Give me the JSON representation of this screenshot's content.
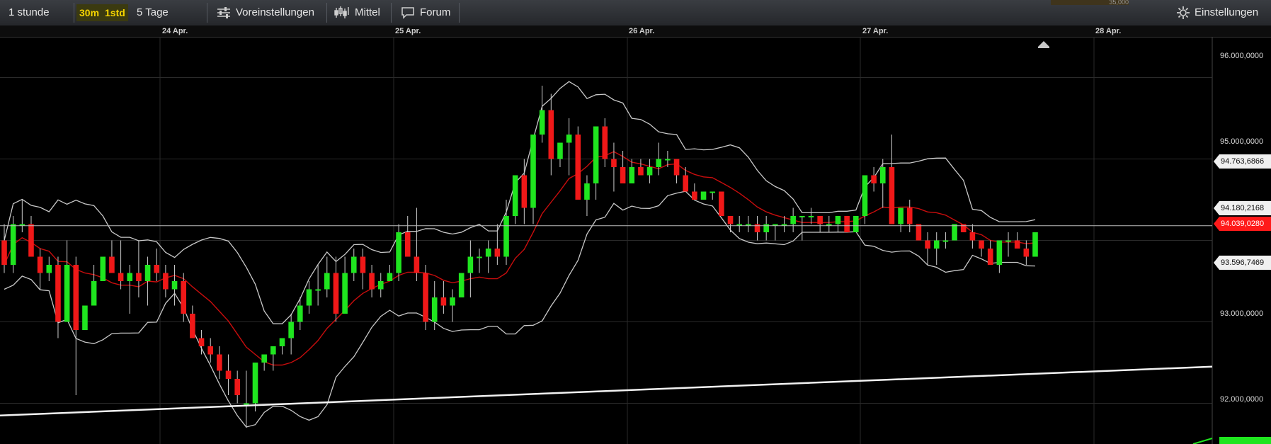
{
  "toolbar": {
    "interval_1h": "1 stunde",
    "interval_30m": "30m",
    "interval_1std": "1std",
    "interval_5d": "5 Tage",
    "presets": "Voreinstellungen",
    "average": "Mittel",
    "forum": "Forum",
    "settings": "Einstellungen",
    "partial_value": "35,000"
  },
  "colors": {
    "up": "#1fe51f",
    "down": "#f01818",
    "sma": "#c80d0d",
    "band": "#c8c8c8",
    "active": "#f5d400"
  },
  "chart_data": {
    "type": "candlestick",
    "x_labels": [
      "24 Apr.",
      "25 Apr.",
      "26 Apr.",
      "27 Apr.",
      "28 Apr."
    ],
    "y_ticks": [
      "96.000,0000",
      "95.000,0000",
      "93.000,0000",
      "92.000,0000"
    ],
    "price_tags": {
      "upper_band": "94.763,6866",
      "current_line": "94.180,2168",
      "last_price": "94.039,0280",
      "lower_band": "93.596,7469"
    },
    "ylim": [
      91.6,
      96.3
    ],
    "candles": [
      [
        94.0,
        94.2,
        93.6,
        93.7
      ],
      [
        93.7,
        94.3,
        93.6,
        94.2
      ],
      [
        94.2,
        94.5,
        94.1,
        94.2
      ],
      [
        94.2,
        94.3,
        93.8,
        93.8
      ],
      [
        93.8,
        93.9,
        93.4,
        93.6
      ],
      [
        93.6,
        93.8,
        93.5,
        93.7
      ],
      [
        93.7,
        93.8,
        92.8,
        93.0
      ],
      [
        93.0,
        94.0,
        93.1,
        93.7
      ],
      [
        93.7,
        93.8,
        92.1,
        92.9
      ],
      [
        92.9,
        93.2,
        92.9,
        93.2
      ],
      [
        93.2,
        93.7,
        93.2,
        93.5
      ],
      [
        93.5,
        93.8,
        93.5,
        93.8
      ],
      [
        93.8,
        94.0,
        93.6,
        93.6
      ],
      [
        93.6,
        94.0,
        93.4,
        93.5
      ],
      [
        93.5,
        93.7,
        93.1,
        93.6
      ],
      [
        93.6,
        94.0,
        93.3,
        93.5
      ],
      [
        93.5,
        93.8,
        93.2,
        93.7
      ],
      [
        93.7,
        93.9,
        93.5,
        93.6
      ],
      [
        93.6,
        93.7,
        93.3,
        93.4
      ],
      [
        93.4,
        93.7,
        93.2,
        93.5
      ],
      [
        93.5,
        93.6,
        93.0,
        93.1
      ],
      [
        93.1,
        93.2,
        92.8,
        92.8
      ],
      [
        92.8,
        92.9,
        92.6,
        92.7
      ],
      [
        92.7,
        92.8,
        92.5,
        92.6
      ],
      [
        92.6,
        92.7,
        92.3,
        92.4
      ],
      [
        92.4,
        92.6,
        92.1,
        92.3
      ],
      [
        92.3,
        92.4,
        92.0,
        92.1
      ],
      [
        92.0,
        92.4,
        91.7,
        92.0
      ],
      [
        92.0,
        92.5,
        91.9,
        92.5
      ],
      [
        92.5,
        92.6,
        92.4,
        92.6
      ],
      [
        92.6,
        92.7,
        92.4,
        92.7
      ],
      [
        92.7,
        92.8,
        92.6,
        92.8
      ],
      [
        92.8,
        93.1,
        92.6,
        93.0
      ],
      [
        93.0,
        93.3,
        92.9,
        93.2
      ],
      [
        93.2,
        93.5,
        93.1,
        93.4
      ],
      [
        93.4,
        93.7,
        93.2,
        93.4
      ],
      [
        93.4,
        93.8,
        93.3,
        93.6
      ],
      [
        93.6,
        93.8,
        93.0,
        93.1
      ],
      [
        93.1,
        93.8,
        93.1,
        93.6
      ],
      [
        93.6,
        93.9,
        93.5,
        93.8
      ],
      [
        93.8,
        93.9,
        93.4,
        93.6
      ],
      [
        93.6,
        93.7,
        93.3,
        93.4
      ],
      [
        93.4,
        93.6,
        93.3,
        93.5
      ],
      [
        93.5,
        93.7,
        93.5,
        93.6
      ],
      [
        93.6,
        94.2,
        93.5,
        94.1
      ],
      [
        94.1,
        94.3,
        93.8,
        93.8
      ],
      [
        93.8,
        94.4,
        93.5,
        93.6
      ],
      [
        93.6,
        93.7,
        92.9,
        93.0
      ],
      [
        93.0,
        93.5,
        92.9,
        93.3
      ],
      [
        93.3,
        93.5,
        93.1,
        93.2
      ],
      [
        93.2,
        93.4,
        93.0,
        93.3
      ],
      [
        93.3,
        93.6,
        93.3,
        93.6
      ],
      [
        93.6,
        94.0,
        93.3,
        93.8
      ],
      [
        93.8,
        93.9,
        93.6,
        93.8
      ],
      [
        93.8,
        94.0,
        93.6,
        93.9
      ],
      [
        93.9,
        94.2,
        93.7,
        93.8
      ],
      [
        93.8,
        94.5,
        93.7,
        94.3
      ],
      [
        94.3,
        94.8,
        94.2,
        94.8
      ],
      [
        94.8,
        95.0,
        94.2,
        94.4
      ],
      [
        94.4,
        95.3,
        94.2,
        95.3
      ],
      [
        95.3,
        95.9,
        95.2,
        95.6
      ],
      [
        95.6,
        95.8,
        94.8,
        95.0
      ],
      [
        95.0,
        95.2,
        94.9,
        95.2
      ],
      [
        95.2,
        95.5,
        94.8,
        95.3
      ],
      [
        95.3,
        95.4,
        94.8,
        94.5
      ],
      [
        94.5,
        94.8,
        94.3,
        94.7
      ],
      [
        94.7,
        95.1,
        94.5,
        95.4
      ],
      [
        95.4,
        95.5,
        94.9,
        95.0
      ],
      [
        95.0,
        95.2,
        94.6,
        94.9
      ],
      [
        94.9,
        95.1,
        94.7,
        94.7
      ],
      [
        94.7,
        95.0,
        94.7,
        94.9
      ],
      [
        94.9,
        95.0,
        94.8,
        94.8
      ],
      [
        94.8,
        95.0,
        94.7,
        94.9
      ],
      [
        94.9,
        95.2,
        94.8,
        95.0
      ],
      [
        95.0,
        95.1,
        94.9,
        95.0
      ],
      [
        95.0,
        95.0,
        94.7,
        94.8
      ],
      [
        94.8,
        94.9,
        94.6,
        94.6
      ],
      [
        94.6,
        94.7,
        94.5,
        94.5
      ],
      [
        94.5,
        94.6,
        94.5,
        94.6
      ],
      [
        94.6,
        94.6,
        94.5,
        94.6
      ],
      [
        94.6,
        94.6,
        94.3,
        94.3
      ],
      [
        94.3,
        94.3,
        94.1,
        94.2
      ],
      [
        94.2,
        94.3,
        94.1,
        94.2
      ],
      [
        94.2,
        94.3,
        94.1,
        94.2
      ],
      [
        94.2,
        94.3,
        94.0,
        94.1
      ],
      [
        94.1,
        94.3,
        94.0,
        94.2
      ],
      [
        94.2,
        94.2,
        94.0,
        94.2
      ],
      [
        94.2,
        94.3,
        94.1,
        94.2
      ],
      [
        94.2,
        94.4,
        94.1,
        94.3
      ],
      [
        94.3,
        94.3,
        94.0,
        94.3
      ],
      [
        94.3,
        94.4,
        94.2,
        94.3
      ],
      [
        94.3,
        94.3,
        94.1,
        94.2
      ],
      [
        94.2,
        94.3,
        94.1,
        94.2
      ],
      [
        94.2,
        94.3,
        94.1,
        94.3
      ],
      [
        94.3,
        94.3,
        94.1,
        94.1
      ],
      [
        94.1,
        94.3,
        94.1,
        94.3
      ],
      [
        94.3,
        94.8,
        94.2,
        94.8
      ],
      [
        94.8,
        94.9,
        94.6,
        94.7
      ],
      [
        94.7,
        95.0,
        94.4,
        94.9
      ],
      [
        94.9,
        95.3,
        94.2,
        94.2
      ],
      [
        94.2,
        94.4,
        94.1,
        94.4
      ],
      [
        94.4,
        94.5,
        94.1,
        94.2
      ],
      [
        94.2,
        94.2,
        94.0,
        94.0
      ],
      [
        94.0,
        94.1,
        93.7,
        93.9
      ],
      [
        93.9,
        94.1,
        93.7,
        94.0
      ],
      [
        94.0,
        94.1,
        93.9,
        94.0
      ],
      [
        94.0,
        94.2,
        94.0,
        94.2
      ],
      [
        94.2,
        94.2,
        94.1,
        94.1
      ],
      [
        94.1,
        94.2,
        93.9,
        94.0
      ],
      [
        94.0,
        94.0,
        93.8,
        93.9
      ],
      [
        93.9,
        94.0,
        93.7,
        93.7
      ],
      [
        93.7,
        94.0,
        93.6,
        94.0
      ],
      [
        94.0,
        94.1,
        93.8,
        94.0
      ],
      [
        94.0,
        94.1,
        93.9,
        93.9
      ],
      [
        93.9,
        94.0,
        93.7,
        93.8
      ],
      [
        93.8,
        94.1,
        93.8,
        94.1
      ]
    ]
  }
}
